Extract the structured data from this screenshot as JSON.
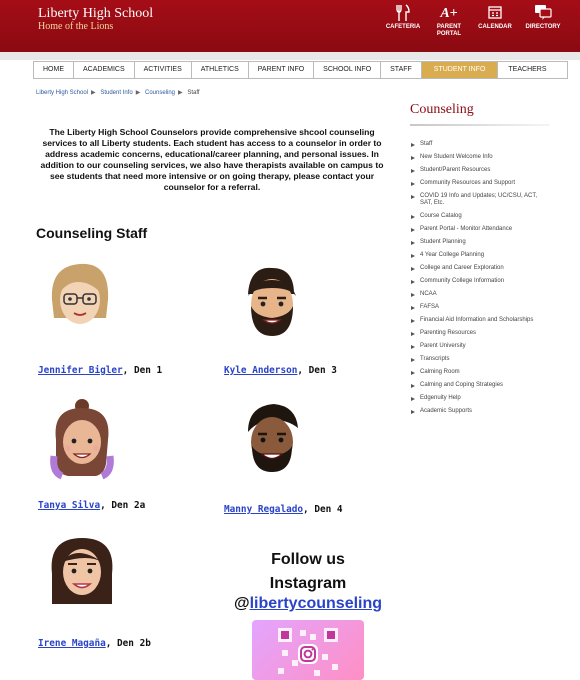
{
  "header": {
    "school_name": "Liberty High School",
    "tagline": "Home of the Lions",
    "links": [
      {
        "label": "CAFETERIA",
        "icon": "fork-knife-icon"
      },
      {
        "label": "PARENT PORTAL",
        "icon": "a-plus-icon"
      },
      {
        "label": "CALENDAR",
        "icon": "calendar-icon"
      },
      {
        "label": "DIRECTORY",
        "icon": "chat-icon"
      }
    ]
  },
  "nav": [
    "HOME",
    "ACADEMICS",
    "ACTIVITIES",
    "ATHLETICS",
    "PARENT INFO",
    "SCHOOL INFO",
    "STAFF",
    "STUDENT INFO",
    "TEACHERS"
  ],
  "nav_active": "STUDENT INFO",
  "breadcrumb": [
    "Liberty High School",
    "Student Info",
    "Counseling",
    "Staff"
  ],
  "intro": "The Liberty High School Counselors provide comprehensive shcool counseling services to all Liberty students. Each student has access to a counselor in order to address academic concerns, educational/career planning, and personal issues. In addition to our counseling services, we also have therapists available on campus to see students that need more intensive or on going therapy, please contact your counselor for a referral.",
  "section_title": "Counseling Staff",
  "staff": [
    {
      "name": "Jennifer Bigler",
      "den": ", Den 1"
    },
    {
      "name": "Kyle Anderson",
      "den": ", Den 3"
    },
    {
      "name": "Tanya Silva",
      "den": ", Den 2a"
    },
    {
      "name": "Manny Regalado",
      "den": ", Den 4"
    },
    {
      "name": "Irene Magaña",
      "den": ", Den 2b"
    }
  ],
  "follow": {
    "line1": "Follow us",
    "line2": "Instagram",
    "at": "@",
    "handle": "libertycounseling"
  },
  "sidebar": {
    "title": "Counseling",
    "items": [
      "Staff",
      "New Student Welcome Info",
      "Student/Parent Resources",
      "Community Resources and Support",
      "COVID 19 Info and Updates; UC/CSU, ACT, SAT, Etc.",
      "Course Catalog",
      "Parent Portal - Monitor Attendance",
      "Student Planning",
      "4 Year College Planning",
      "College and Career Exploration",
      "Community College Information",
      "NCAA",
      "FAFSA",
      "Financial Aid Information and Scholarships",
      "Parenting Resources",
      "Parent University",
      "Transcripts",
      "Calming Room",
      "Calming and Coping Strategies",
      "Edgenuity Help",
      "Academic Supports"
    ]
  },
  "colors": {
    "header": "#a50d16",
    "accent": "#d9ad4f",
    "link": "#2a44c9"
  }
}
